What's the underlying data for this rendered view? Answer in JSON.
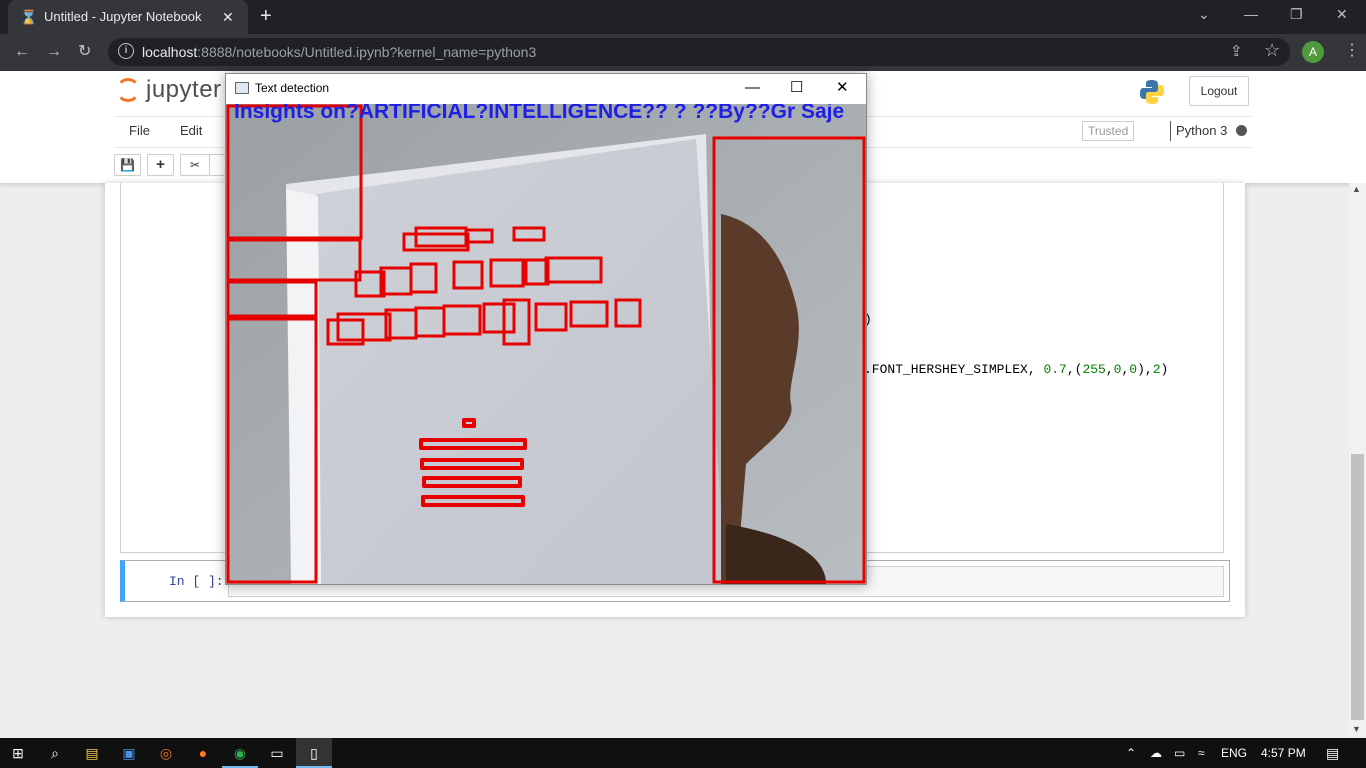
{
  "browser": {
    "tab_title": "Untitled - Jupyter Notebook",
    "url_host": "localhost",
    "url_path": ":8888/notebooks/Untitled.ipynb?kernel_name=python3",
    "avatar_letter": "A"
  },
  "jupyter": {
    "logo_text": "jupyter",
    "logout_label": "Logout",
    "menu": [
      "File",
      "Edit"
    ],
    "trusted_label": "Trusted",
    "kernel_name": "Python 3",
    "code_fragments": {
      "line1_end": ")",
      "line2_prefix": ".FONT_HERSHEY_SIMPLEX, ",
      "line2_n1": "0.7",
      "line2_mid": ",(",
      "line2_n2": "255",
      "line2_c1": ",",
      "line2_n3": "0",
      "line2_c2": ",",
      "line2_n4": "0",
      "line2_mid2": "),",
      "line2_n5": "2",
      "line2_end": ")"
    },
    "prompt": "In [ ]:"
  },
  "cv_window": {
    "title": "Text detection",
    "detected_text": "Insights  on?ARTIFICIAL?INTELLIGENCE??    ?  ??By??Gr  Saje",
    "box_color": "#e60000",
    "overlay_text_color": "#1f1fe6"
  },
  "taskbar": {
    "language": "ENG",
    "time": "4:57 PM"
  }
}
